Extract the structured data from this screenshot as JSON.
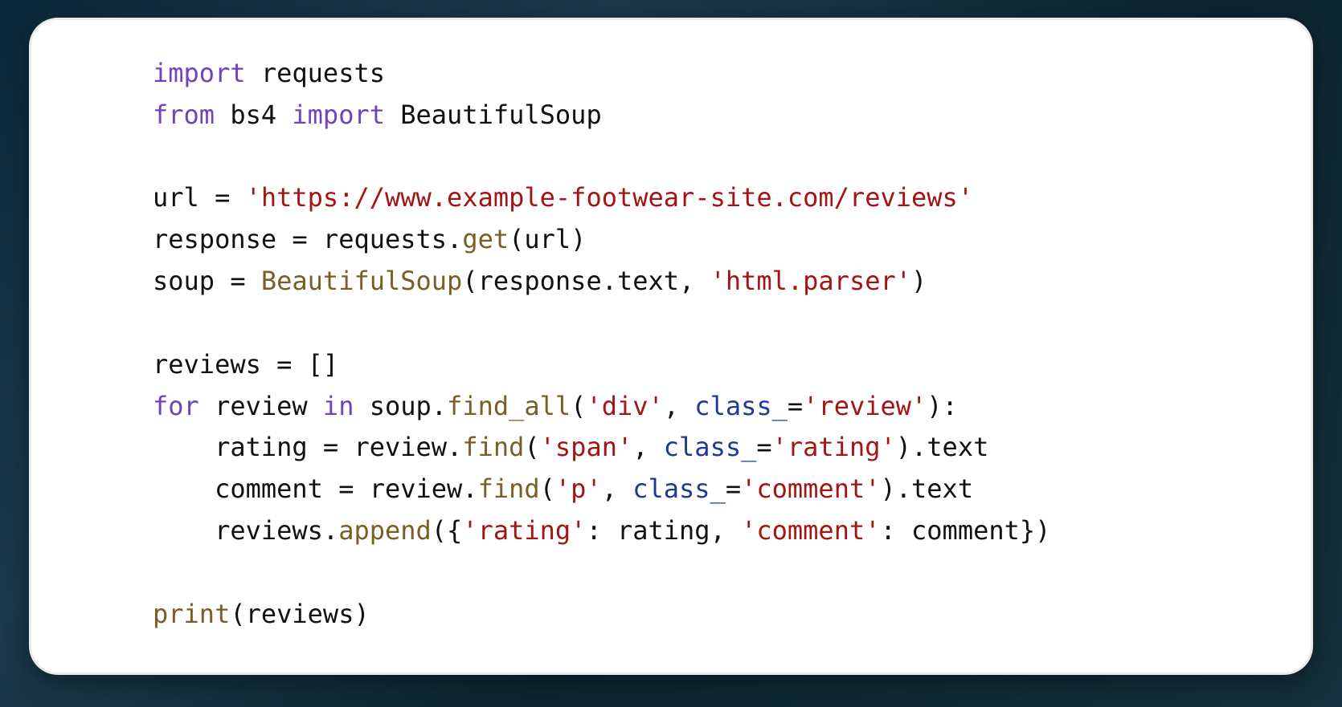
{
  "tokens": {
    "kw_import": "import",
    "kw_from": "from",
    "kw_for": "for",
    "kw_in": "in",
    "id_requests": "requests",
    "id_bs4": "bs4",
    "id_BeautifulSoup": "BeautifulSoup",
    "id_url": "url",
    "id_response": "response",
    "id_soup": "soup",
    "id_reviews": "reviews",
    "id_review": "review",
    "id_rating": "rating",
    "id_comment": "comment",
    "id_class_": "class_",
    "fn_get": "get",
    "fn_find_all": "find_all",
    "fn_find": "find",
    "fn_append": "append",
    "fn_print": "print",
    "attr_text": "text",
    "str_url": "'https://www.example-footwear-site.com/reviews'",
    "str_html_parser": "'html.parser'",
    "str_div": "'div'",
    "str_review": "'review'",
    "str_span": "'span'",
    "str_rating": "'rating'",
    "str_p": "'p'",
    "str_comment": "'comment'",
    "punct_eq": " = ",
    "punct_empty_list": "[]",
    "punct_dot": ".",
    "punct_open": "(",
    "punct_close": ")",
    "punct_colon": ":",
    "punct_comma_sp": ", ",
    "punct_colon_sp": ": ",
    "punct_brace_open": "{",
    "punct_brace_close": "}",
    "sp1": " ",
    "indent": "    "
  },
  "code_plain": "import requests\nfrom bs4 import BeautifulSoup\n\nurl = 'https://www.example-footwear-site.com/reviews'\nresponse = requests.get(url)\nsoup = BeautifulSoup(response.text, 'html.parser')\n\nreviews = []\nfor review in soup.find_all('div', class_='review'):\n    rating = review.find('span', class_='rating').text\n    comment = review.find('p', class_='comment').text\n    reviews.append({'rating': rating, 'comment': comment})\n\nprint(reviews)"
}
